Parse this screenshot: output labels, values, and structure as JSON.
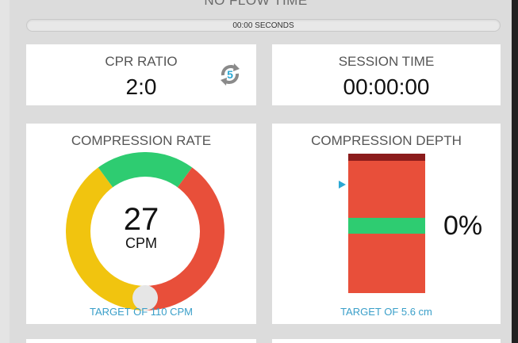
{
  "header": {
    "title": "NO FLOW TIME",
    "bar_text": "00:00 SECONDS"
  },
  "cpr_ratio": {
    "title": "CPR RATIO",
    "value": "2:0",
    "cycle_count": "5",
    "cycle_icon": "refresh-cycle-icon"
  },
  "session_time": {
    "title": "SESSION TIME",
    "value": "00:00:00"
  },
  "compression_rate": {
    "title": "COMPRESSION RATE",
    "value": "27",
    "unit": "CPM",
    "target": "TARGET OF 110 CPM",
    "indicator_fraction": 0.5
  },
  "compression_depth": {
    "title": "COMPRESSION DEPTH",
    "percent": "0%",
    "target": "TARGET OF 5.6 cm"
  },
  "colors": {
    "accent": "#2ba8d4",
    "green": "#2ecc71",
    "yellow": "#f1c40f",
    "red": "#e84f3a",
    "dark_red": "#8b1c1c"
  }
}
